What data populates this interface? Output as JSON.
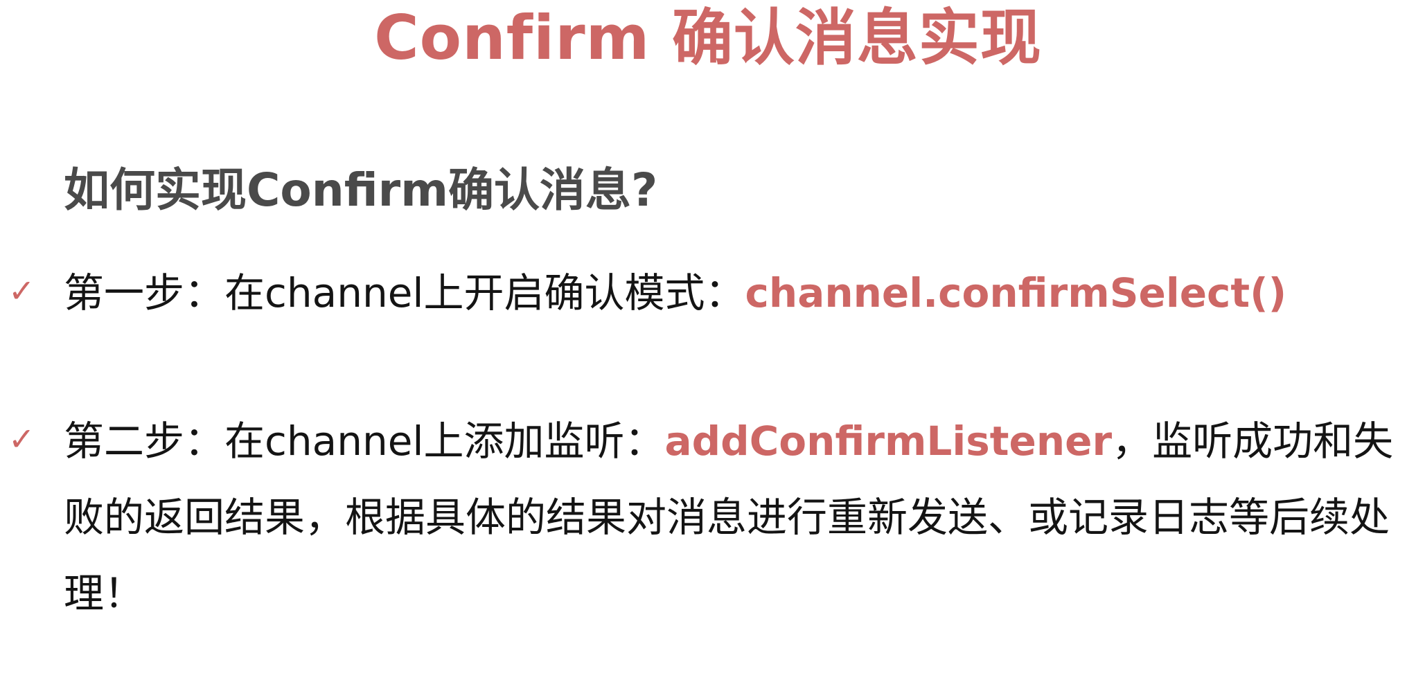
{
  "slide": {
    "title": "Confirm 确认消息实现",
    "question": "如何实现Confirm确认消息?",
    "check_icon": "✓",
    "accent_color": "#cd6765",
    "steps": [
      {
        "prefix": "第一步：在channel上开启确认模式：",
        "highlight": "channel.confirmSelect()",
        "suffix": ""
      },
      {
        "prefix": "第二步：在channel上添加监听：",
        "highlight": "addConfirmListener",
        "suffix": "，监听成功和失败的返回结果，根据具体的结果对消息进行重新发送、或记录日志等后续处理！"
      }
    ]
  }
}
